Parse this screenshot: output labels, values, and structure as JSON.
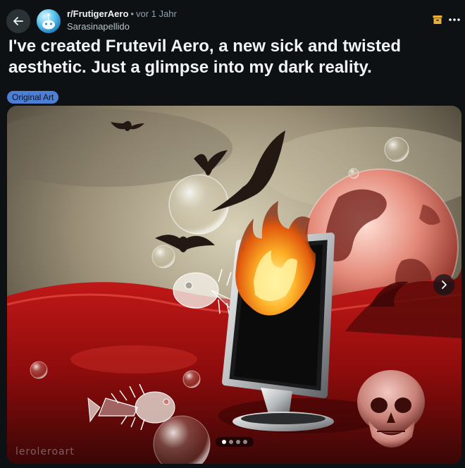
{
  "post": {
    "subreddit": "r/FrutigerAero",
    "separator": "•",
    "age": "vor 1 Jahr",
    "author": "Sarasinapellido",
    "title": "I've created Frutevil Aero, a new sick and twisted aesthetic. Just a glimpse into my dark reality.",
    "flair": "Original Art"
  },
  "media": {
    "watermark": "leroleroart",
    "gallery": {
      "slide_count": 4,
      "current_slide": 1
    }
  },
  "icons": {
    "back": "arrow-left-icon",
    "archive": "archive-icon",
    "more": "ellipsis-icon",
    "next": "chevron-right-icon"
  },
  "colors": {
    "background": "#0e1113",
    "flair_background": "#4d7fd6",
    "button_background": "#2a3236",
    "archive_icon": "#e8b03a"
  }
}
